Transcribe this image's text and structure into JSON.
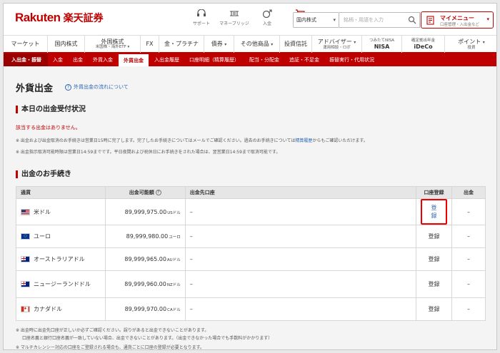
{
  "header": {
    "logo": "Rakuten",
    "logo_jp": "楽天証券",
    "icons": [
      {
        "label": "サポート",
        "icon": "support-icon"
      },
      {
        "label": "マネーブリッジ",
        "icon": "money-bridge-icon"
      },
      {
        "label": "入金",
        "icon": "deposit-icon"
      },
      {
        "label": "注文",
        "icon": "order-cart-icon"
      }
    ],
    "search_select": "国内株式",
    "search_placeholder": "銘柄・用語を入力",
    "mymenu_title": "マイメニュー",
    "mymenu_sub": "口座管理・入出金など"
  },
  "main_nav": [
    {
      "label": "マーケット",
      "sub": ""
    },
    {
      "label": "国内株式",
      "sub": ""
    },
    {
      "label": "外国株式",
      "sub": "米国株・海外ETF"
    },
    {
      "label": "FX",
      "sub": ""
    },
    {
      "label": "金・プラチナ",
      "sub": ""
    },
    {
      "label": "債券",
      "sub": ""
    },
    {
      "label": "その他商品",
      "sub": ""
    },
    {
      "label": "投資信託",
      "sub": ""
    },
    {
      "label": "アドバイザー",
      "sub": "運用相談・ロボ"
    },
    {
      "label": "つみたてNISA",
      "sub": "NISA"
    },
    {
      "label": "確定拠出年金",
      "sub": "iDeCo"
    },
    {
      "label": "ポイント",
      "sub": "投資"
    }
  ],
  "sub_nav": {
    "section": "入出金・振替",
    "items": [
      "入金",
      "出金",
      "外貨入金",
      "外貨出金",
      "入出金履歴",
      "口座明細（精算履歴）",
      "配当・分配金",
      "追証・不足金",
      "振替実行・代用状況"
    ],
    "active": "外貨出金"
  },
  "page": {
    "title": "外貨出金",
    "flow_link": "外貨出金の流れについて",
    "section1": "本日の出金受付状況",
    "notice": "該当する出金はありません。",
    "note1": "※ 出金および出金取消のお手続きは営業日15時に完了します。完了したお手続きについてはメールでご確認ください。過去のお手続きについては",
    "note1_link": "精算履歴",
    "note1_tail": "からもご確認いただけます。",
    "note2": "※ 出金指示取消可能時限は営業日14:59までです。平日夜間および祝休日にお手続きをされた場合は、翌営業日14:59まで取消可能です。",
    "section2": "出金のお手続き"
  },
  "table": {
    "headers": [
      "通貨",
      "出金可能額",
      "出金先口座",
      "口座登録",
      "出金"
    ],
    "rows": [
      {
        "currency": "米ドル",
        "flag": "us",
        "amount": "89,999,975.00",
        "unit": "USドル",
        "dest": "–",
        "reg": "登録",
        "out": "–"
      },
      {
        "currency": "ユーロ",
        "flag": "eu",
        "amount": "89,999,980.00",
        "unit": "ユーロ",
        "dest": "–",
        "reg": "登録",
        "out": "–"
      },
      {
        "currency": "オーストラリアドル",
        "flag": "au",
        "amount": "89,999,965.00",
        "unit": "AUドル",
        "dest": "–",
        "reg": "登録",
        "out": "–"
      },
      {
        "currency": "ニュージーランドドル",
        "flag": "nz",
        "amount": "89,999,960.00",
        "unit": "NZドル",
        "dest": "–",
        "reg": "登録",
        "out": "–"
      },
      {
        "currency": "カナダドル",
        "flag": "ca",
        "amount": "89,999,970.00",
        "unit": "CAドル",
        "dest": "–",
        "reg": "登録",
        "out": "–"
      }
    ]
  },
  "footer": {
    "note1": "※ 出金時に出金先口座が正しいか必ずご確認ください。誤りがあると出金できないことがあります。",
    "note1b": "口座名義と銀行口座名義が一致していない場合、出金できないことがあります。（出金できなかった場合でも手数料がかかります）",
    "note2": "※ マルチカレンシー対応の口座をご登録される場合も、通貨ごとに口座の登録が必要となります。"
  },
  "colors": {
    "brand": "#bf0000",
    "link": "#2a64b5",
    "highlight": "#e00000"
  }
}
